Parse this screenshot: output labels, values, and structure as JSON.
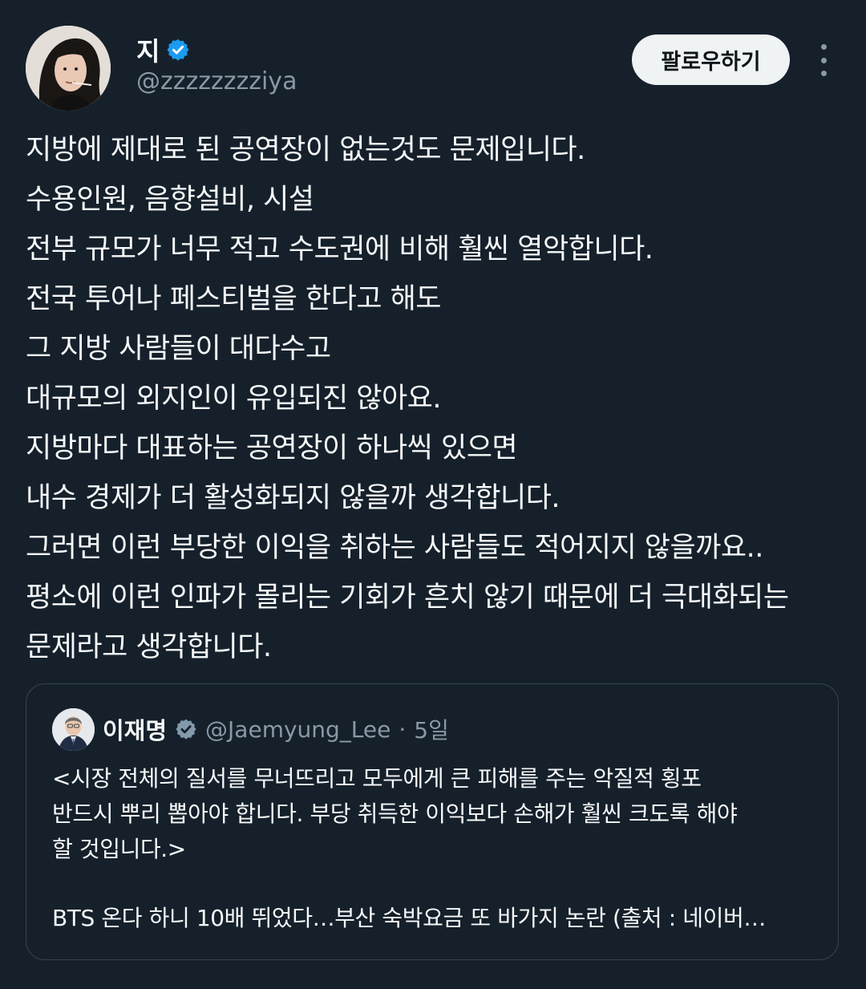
{
  "author": {
    "display_name": "지",
    "handle": "@zzzzzzzziya",
    "avatar_icon": "profile-photo",
    "verified_icon": "verified-badge-icon",
    "verified_color": "#1d9bf0"
  },
  "actions": {
    "follow_label": "팔로우하기",
    "more_icon": "more-vertical-icon"
  },
  "tweet_lines": [
    "지방에 제대로 된 공연장이 없는것도 문제입니다.",
    "수용인원, 음향설비, 시설",
    "전부 규모가 너무 적고 수도권에 비해 훨씬 열악합니다.",
    "전국 투어나 페스티벌을 한다고 해도",
    "그 지방 사람들이 대다수고",
    "대규모의 외지인이 유입되진 않아요.",
    "지방마다 대표하는 공연장이 하나씩 있으면",
    "내수 경제가 더 활성화되지 않을까 생각합니다.",
    "그러면 이런 부당한 이익을 취하는 사람들도 적어지지 않을까요..",
    "평소에 이런 인파가 몰리는 기회가 흔치 않기 때문에 더 극대화되는",
    "문제라고 생각합니다."
  ],
  "quote": {
    "display_name": "이재명",
    "handle": "@Jaemyung_Lee",
    "separator": "·",
    "time": "5일",
    "avatar_icon": "profile-photo",
    "verified_icon": "verified-gray-badge-icon",
    "lines": [
      "<시장 전체의 질서를 무너뜨리고 모두에게 큰 피해를 주는 악질적 횡포",
      "반드시 뿌리 뽑아야 합니다. 부당 취득한 이익보다 손해가 훨씬 크도록 해야",
      "할 것입니다.>"
    ],
    "link_line": "BTS 온다 하니 10배 뛰었다…부산 숙박요금 또 바가지 논란 (출처 : 네이버…"
  },
  "colors": {
    "background": "#15202b",
    "text_primary": "#f7f9f9",
    "text_secondary": "#8b98a5",
    "border": "#38444d",
    "accent": "#1d9bf0"
  }
}
